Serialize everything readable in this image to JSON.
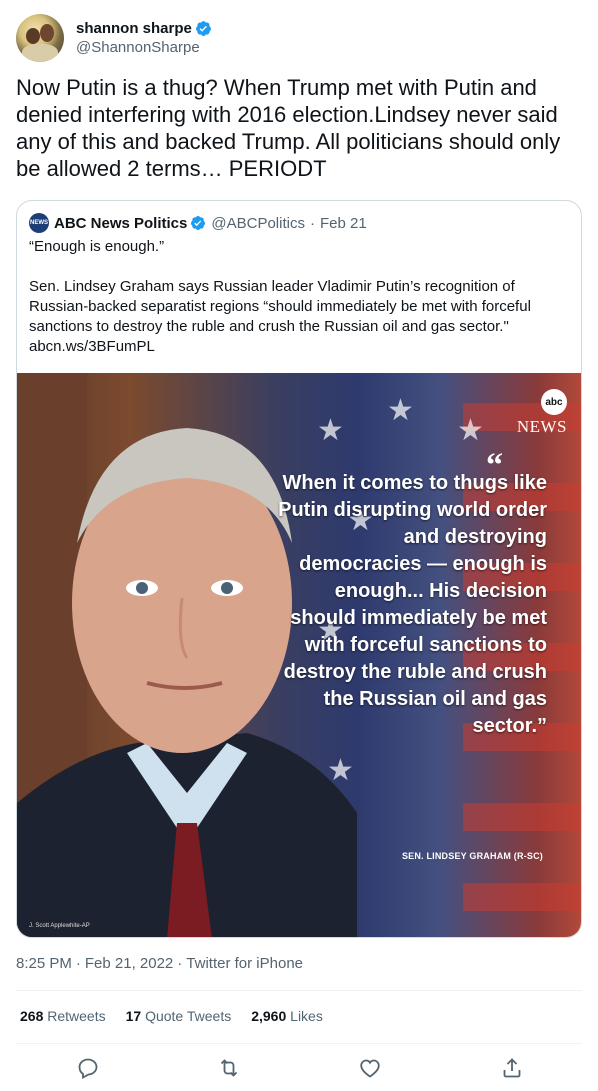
{
  "author": {
    "display_name": "shannon sharpe",
    "handle": "@ShannonSharpe",
    "verified": true
  },
  "tweet": {
    "text": "Now Putin is a thug? When Trump met with Putin and denied interfering with 2016 election.Lindsey never said any of this and backed Trump. All politicians should only be allowed 2 terms… PERIODT"
  },
  "quoted_tweet": {
    "avatar_text": "NEWS",
    "display_name": "ABC News Politics",
    "handle": "@ABCPolitics",
    "separator": "·",
    "date": "Feb 21",
    "line1": "“Enough is enough.”",
    "line2": "Sen. Lindsey Graham says Russian leader Vladimir Putin’s recognition of Russian-backed separatist regions “should immediately be met with forceful sanctions to destroy the ruble and crush the Russian oil and gas sector.\"",
    "link": "abcn.ws/3BFumPL",
    "image": {
      "logo_text": "abc",
      "brand_text": "NEWS",
      "quote_mark": "“",
      "quote": "When it comes to thugs like Putin disrupting world order and destroying democracies — enough is enough... His decision should immediately be met with forceful sanctions to destroy the ruble and crush the Russian oil and gas sector.”",
      "attribution": "SEN. LINDSEY GRAHAM (R-SC)",
      "photo_credit": "J. Scott Applewhite-AP"
    }
  },
  "meta": {
    "time": "8:25 PM",
    "date": "Feb 21, 2022",
    "source": "Twitter for iPhone",
    "dot": "·"
  },
  "stats": {
    "retweets_count": "268",
    "retweets_label": "Retweets",
    "quotes_count": "17",
    "quotes_label": "Quote Tweets",
    "likes_count": "2,960",
    "likes_label": "Likes"
  },
  "colors": {
    "verified_blue": "#1d9bf0",
    "secondary_text": "#536471",
    "border": "#cfd9de"
  },
  "icons": [
    "reply-icon",
    "retweet-icon",
    "like-icon",
    "share-icon"
  ]
}
